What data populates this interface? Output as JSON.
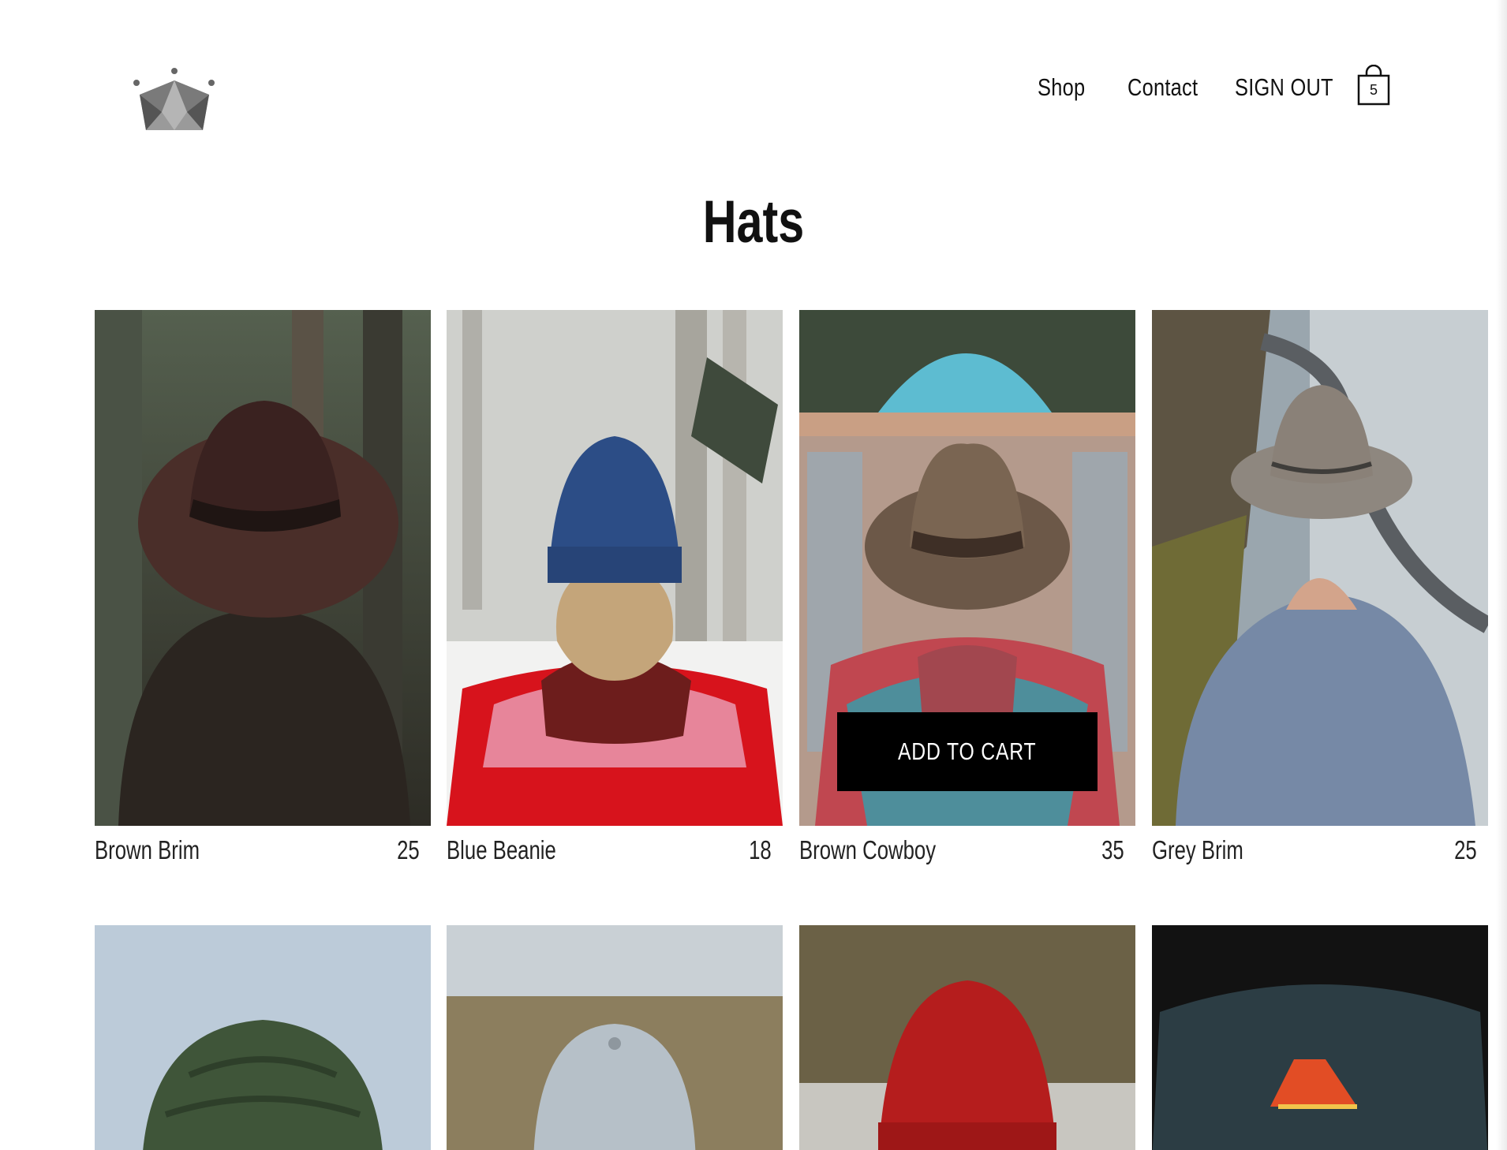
{
  "header": {
    "logo": "crown-logo",
    "nav": [
      {
        "label": "Shop"
      },
      {
        "label": "Contact"
      },
      {
        "label": "SIGN OUT"
      }
    ],
    "cart": {
      "icon": "shopping-bag-icon",
      "count": "5"
    }
  },
  "page": {
    "title": "Hats"
  },
  "products": [
    {
      "name": "Brown Brim",
      "price": "25"
    },
    {
      "name": "Blue Beanie",
      "price": "18"
    },
    {
      "name": "Brown Cowboy",
      "price": "35"
    },
    {
      "name": "Grey Brim",
      "price": "25"
    }
  ],
  "hover_card": {
    "add_to_cart_label": "ADD TO CART"
  },
  "colors": {
    "button_bg": "#000000",
    "text": "#111111",
    "background": "#ffffff"
  }
}
